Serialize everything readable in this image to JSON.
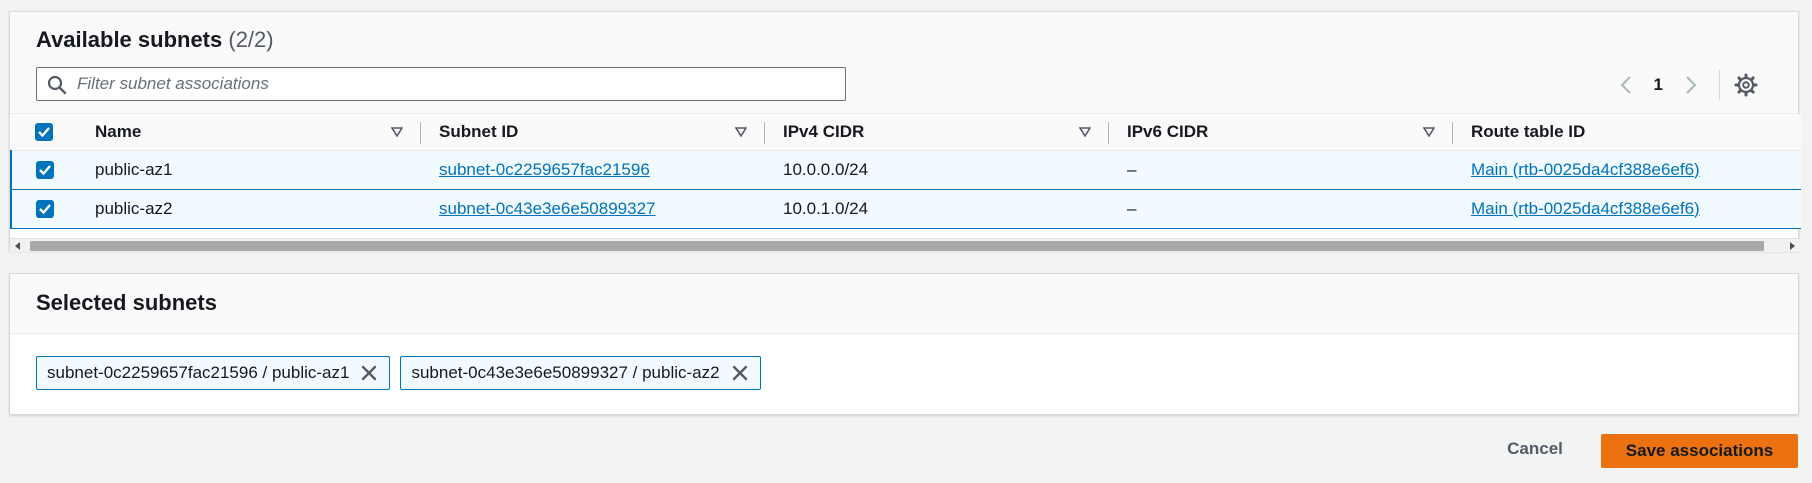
{
  "available": {
    "title": "Available subnets",
    "count": "(2/2)",
    "filter_placeholder": "Filter subnet associations",
    "page": "1",
    "columns": [
      "Name",
      "Subnet ID",
      "IPv4 CIDR",
      "IPv6 CIDR",
      "Route table ID"
    ],
    "rows": [
      {
        "name": "public-az1",
        "subnet_id": "subnet-0c2259657fac21596",
        "ipv4": "10.0.0.0/24",
        "ipv6": "–",
        "route_table": "Main (rtb-0025da4cf388e6ef6)"
      },
      {
        "name": "public-az2",
        "subnet_id": "subnet-0c43e3e6e50899327",
        "ipv4": "10.0.1.0/24",
        "ipv6": "–",
        "route_table": "Main (rtb-0025da4cf388e6ef6)"
      }
    ]
  },
  "selected": {
    "title": "Selected subnets",
    "tokens": [
      "subnet-0c2259657fac21596 / public-az1",
      "subnet-0c43e3e6e50899327 / public-az2"
    ]
  },
  "actions": {
    "cancel": "Cancel",
    "save": "Save associations"
  },
  "colors": {
    "accent": "#0073bb",
    "primary_button": "#ec7211",
    "selected_row_bg": "#f1faff"
  }
}
